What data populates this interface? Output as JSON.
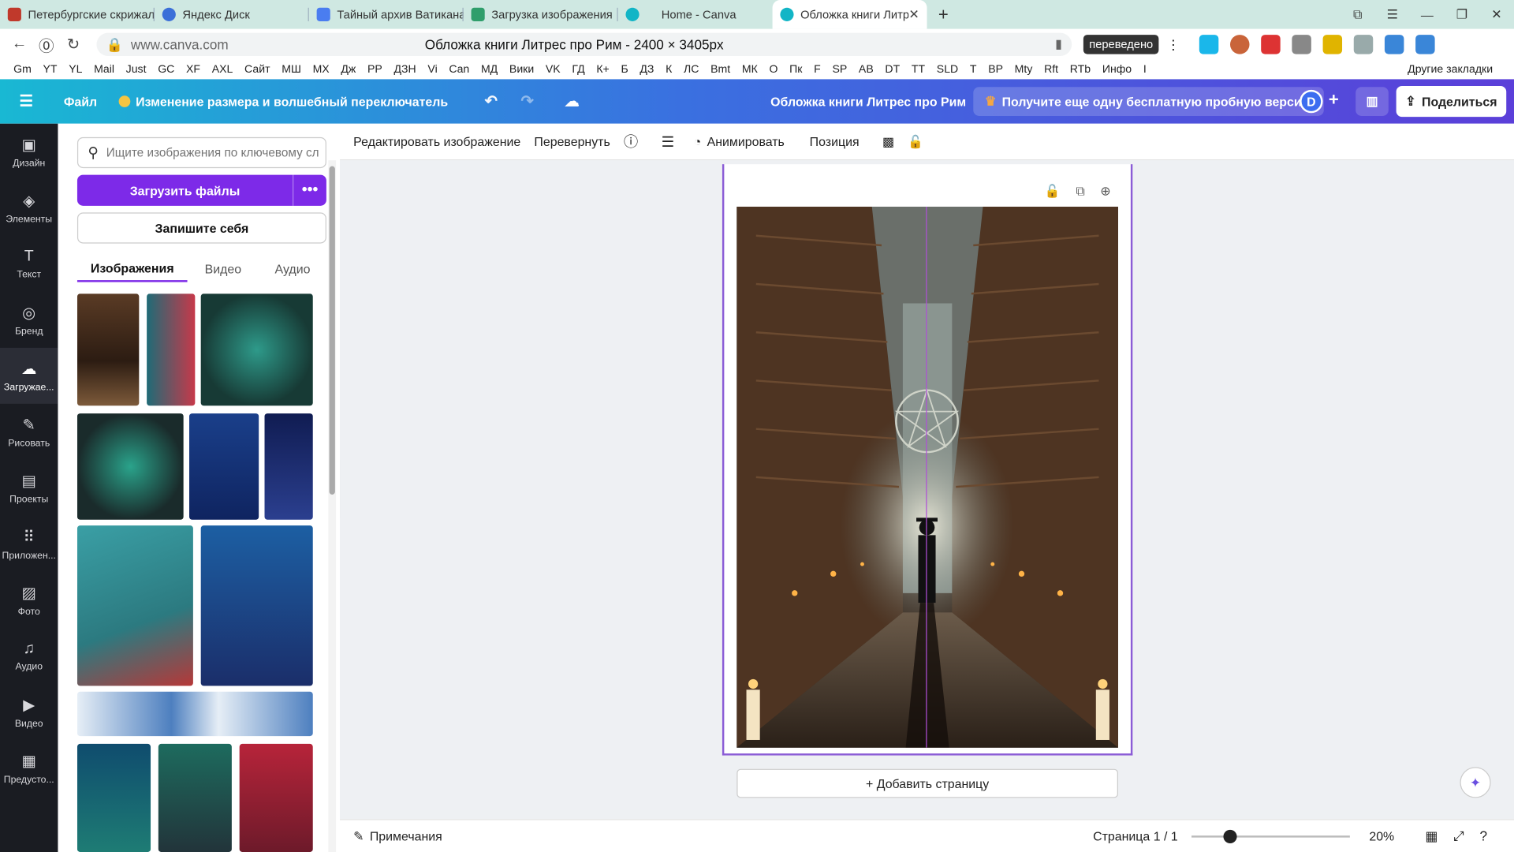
{
  "browser": {
    "tabs": [
      {
        "label": "Петербургские скрижали",
        "icon": "red-book-icon",
        "color": "#c0392b"
      },
      {
        "label": "Яндекс Диск",
        "icon": "yandex-disk-icon",
        "color": "#3b6fd8"
      },
      {
        "label": "Тайный архив Ватикана",
        "icon": "document-icon",
        "color": "#4a7df0"
      },
      {
        "label": "Загрузка изображения",
        "icon": "image-icon",
        "color": "#2f9e6b"
      },
      {
        "label": "Home - Canva",
        "icon": "canva-icon",
        "color": "#12b5c6"
      },
      {
        "label": "Обложка книги Литрес",
        "icon": "canva-icon",
        "color": "#12b5c6",
        "active": true
      }
    ],
    "close_glyph": "✕",
    "new_tab_glyph": "+",
    "window_controls": [
      "⧉",
      "☰",
      "—",
      "❐",
      "✕"
    ],
    "url": "www.canva.com",
    "page_title": "Обложка книги Литрес про Рим - 2400 × 3405px",
    "translated_badge": "переведено",
    "bookmarks": [
      "Gm",
      "YT",
      "YL",
      "Mail",
      "Just",
      "GC",
      "XF",
      "AXL",
      "Сайт",
      "МШ",
      "МХ",
      "Дж",
      "РР",
      "ДЗН",
      "Vi",
      "Can",
      "МД",
      "Вики",
      "VK",
      "ГД",
      "К+",
      "Б",
      "ДЗ",
      "К",
      "ЛС",
      "Bmt",
      "МК",
      "О",
      "Пк",
      "F",
      "SP",
      "АВ",
      "DT",
      "TT",
      "SLD",
      "T",
      "ВР",
      "Mty",
      "Rft",
      "RTb",
      "Инфо",
      "I"
    ],
    "other_bookmarks": "Другие закладки"
  },
  "canva": {
    "menu_glyph": "☰",
    "file": "Файл",
    "magic_resize": "Изменение размера и волшебный переключатель",
    "undo_glyph": "↶",
    "redo_glyph": "↷",
    "cloud_glyph": "☁",
    "doc_title": "Обложка книги Литрес про Рим",
    "trial": "Получите еще одну бесплатную пробную версию",
    "crown_glyph": "♛",
    "avatar_letter": "D",
    "plus_glyph": "+",
    "stats_glyph": "▥",
    "share": "Поделиться",
    "share_glyph": "⇪"
  },
  "rail": [
    {
      "label": "Дизайн",
      "icon": "layout-icon",
      "glyph": "▣"
    },
    {
      "label": "Элементы",
      "icon": "shapes-icon",
      "glyph": "◈"
    },
    {
      "label": "Текст",
      "icon": "text-icon",
      "glyph": "T"
    },
    {
      "label": "Бренд",
      "icon": "brand-icon",
      "glyph": "◎"
    },
    {
      "label": "Загружае...",
      "icon": "cloud-upload-icon",
      "glyph": "☁",
      "active": true
    },
    {
      "label": "Рисовать",
      "icon": "pen-icon",
      "glyph": "✎"
    },
    {
      "label": "Проекты",
      "icon": "folder-icon",
      "glyph": "▤"
    },
    {
      "label": "Приложен...",
      "icon": "apps-icon",
      "glyph": "⠿"
    },
    {
      "label": "Фото",
      "icon": "photo-icon",
      "glyph": "▨"
    },
    {
      "label": "Аудио",
      "icon": "music-icon",
      "glyph": "♫"
    },
    {
      "label": "Видео",
      "icon": "video-icon",
      "glyph": "▶"
    },
    {
      "label": "Предусто...",
      "icon": "pattern-icon",
      "glyph": "▦"
    }
  ],
  "panel": {
    "search_placeholder": "Ищите изображения по ключевому сл",
    "search_glyph": "⚲",
    "upload": "Загрузить файлы",
    "more_glyph": "•••",
    "record": "Запишите себя",
    "tabs": [
      "Изображения",
      "Видео",
      "Аудио"
    ],
    "active_tab": "Изображения"
  },
  "context_toolbar": {
    "edit_image": "Редактировать изображение",
    "flip": "Перевернуть",
    "info_glyph": "ⓘ",
    "lines_glyph": "☰",
    "animate": "Анимировать",
    "animate_glyph": "◔",
    "position": "Позиция",
    "transparency_glyph": "▩",
    "lock_glyph": "🔓"
  },
  "page_actions": {
    "lock": "🔓",
    "duplicate": "⧉",
    "add": "⊕"
  },
  "canvas": {
    "add_page": "+ Добавить страницу",
    "assistant_glyph": "✦"
  },
  "footer": {
    "notes": "Примечания",
    "notes_glyph": "✎",
    "page_indicator": "Страница 1 / 1",
    "zoom_percent": 20,
    "zoom_label": "20%",
    "grid_glyph": "▦",
    "fullscreen_glyph": "⤢",
    "help_glyph": "?"
  },
  "colors": {
    "canva_purple": "#7d2ae8",
    "selection_border": "#8b5cd6"
  }
}
